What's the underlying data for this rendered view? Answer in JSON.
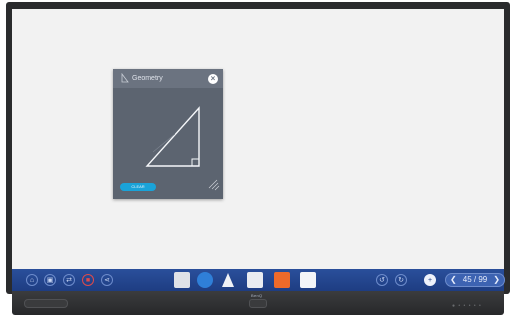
{
  "geometry_window": {
    "title": "Geometry",
    "clear_label": "CLEAR",
    "close_glyph": "×",
    "title_icon": "ruler-icon"
  },
  "taskbar": {
    "left_icons": [
      "home-icon",
      "whiteboard-icon",
      "switch-icon",
      "stop-icon",
      "share-icon"
    ],
    "apps": [
      "gallery-app",
      "browser-app",
      "tools-app",
      "display-app",
      "toolbox-app",
      "notes-app"
    ],
    "right_icons": [
      "undo-icon",
      "redo-icon",
      "add-page-icon"
    ],
    "pager": {
      "current": "45",
      "total": "99",
      "display": "45 / 99"
    }
  },
  "bezel": {
    "brand": "BenQ"
  },
  "colors": {
    "taskbar": "#1e3d82",
    "window_body": "#5c6470",
    "window_title": "#6b7380",
    "accent": "#1aa3d9",
    "stop_red": "#e04a4a"
  }
}
